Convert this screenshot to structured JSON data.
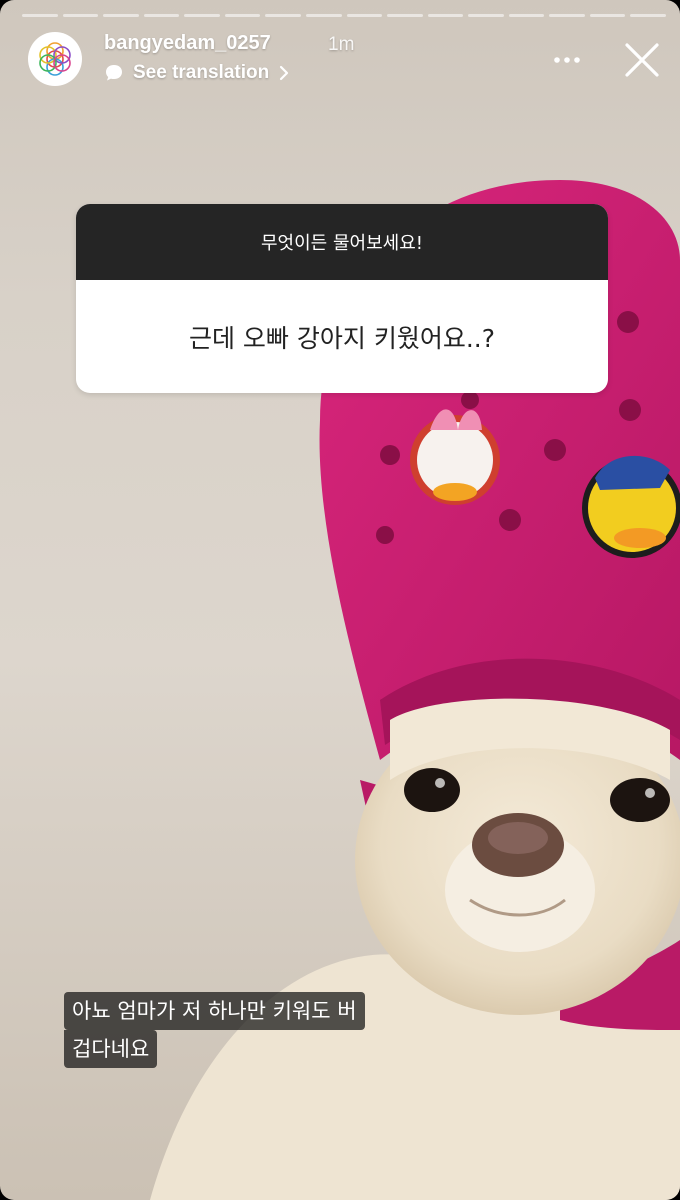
{
  "story": {
    "progress_segments": 16,
    "username": "bangyedam_0257",
    "timestamp": "1m",
    "see_translation_label": "See translation"
  },
  "question_sticker": {
    "prompt": "무엇이든 물어보세요!",
    "question": "근데 오빠 강아지 키웠어요..?"
  },
  "caption": {
    "lines": [
      "아뇨 엄마가 저 하나만 키워도 버",
      "겁다네요"
    ]
  },
  "icons": {
    "avatar": "flower-of-life-logo",
    "translation": "speech-bubble-icon",
    "chevron": "chevron-right-icon",
    "more": "more-dots-icon",
    "close": "close-icon"
  },
  "colors": {
    "sticker_header_bg": "#252525",
    "crocs_pink": "#c51f6e"
  }
}
